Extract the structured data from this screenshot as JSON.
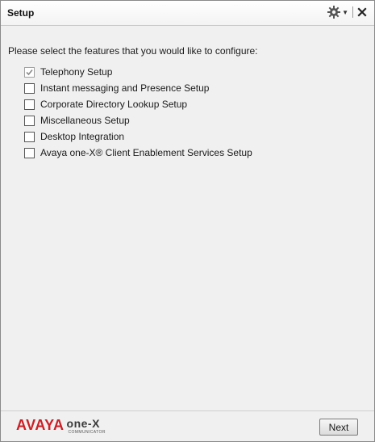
{
  "window": {
    "title": "Setup"
  },
  "content": {
    "prompt": "Please select the features that you would like to configure:"
  },
  "options": [
    {
      "label": "Telephony Setup",
      "checked": true,
      "disabled": true
    },
    {
      "label": "Instant messaging and Presence Setup",
      "checked": false,
      "disabled": false
    },
    {
      "label": "Corporate Directory Lookup Setup",
      "checked": false,
      "disabled": false
    },
    {
      "label": "Miscellaneous Setup",
      "checked": false,
      "disabled": false
    },
    {
      "label": "Desktop Integration",
      "checked": false,
      "disabled": false
    },
    {
      "label": "Avaya one-X® Client Enablement Services Setup",
      "checked": false,
      "disabled": false
    }
  ],
  "footer": {
    "logo_brand": "AVAYA",
    "logo_product": "one-X",
    "logo_sub": "COMMUNICATOR",
    "next_label": "Next"
  },
  "colors": {
    "brand_red": "#cc1f26",
    "background": "#f0f0f0"
  }
}
